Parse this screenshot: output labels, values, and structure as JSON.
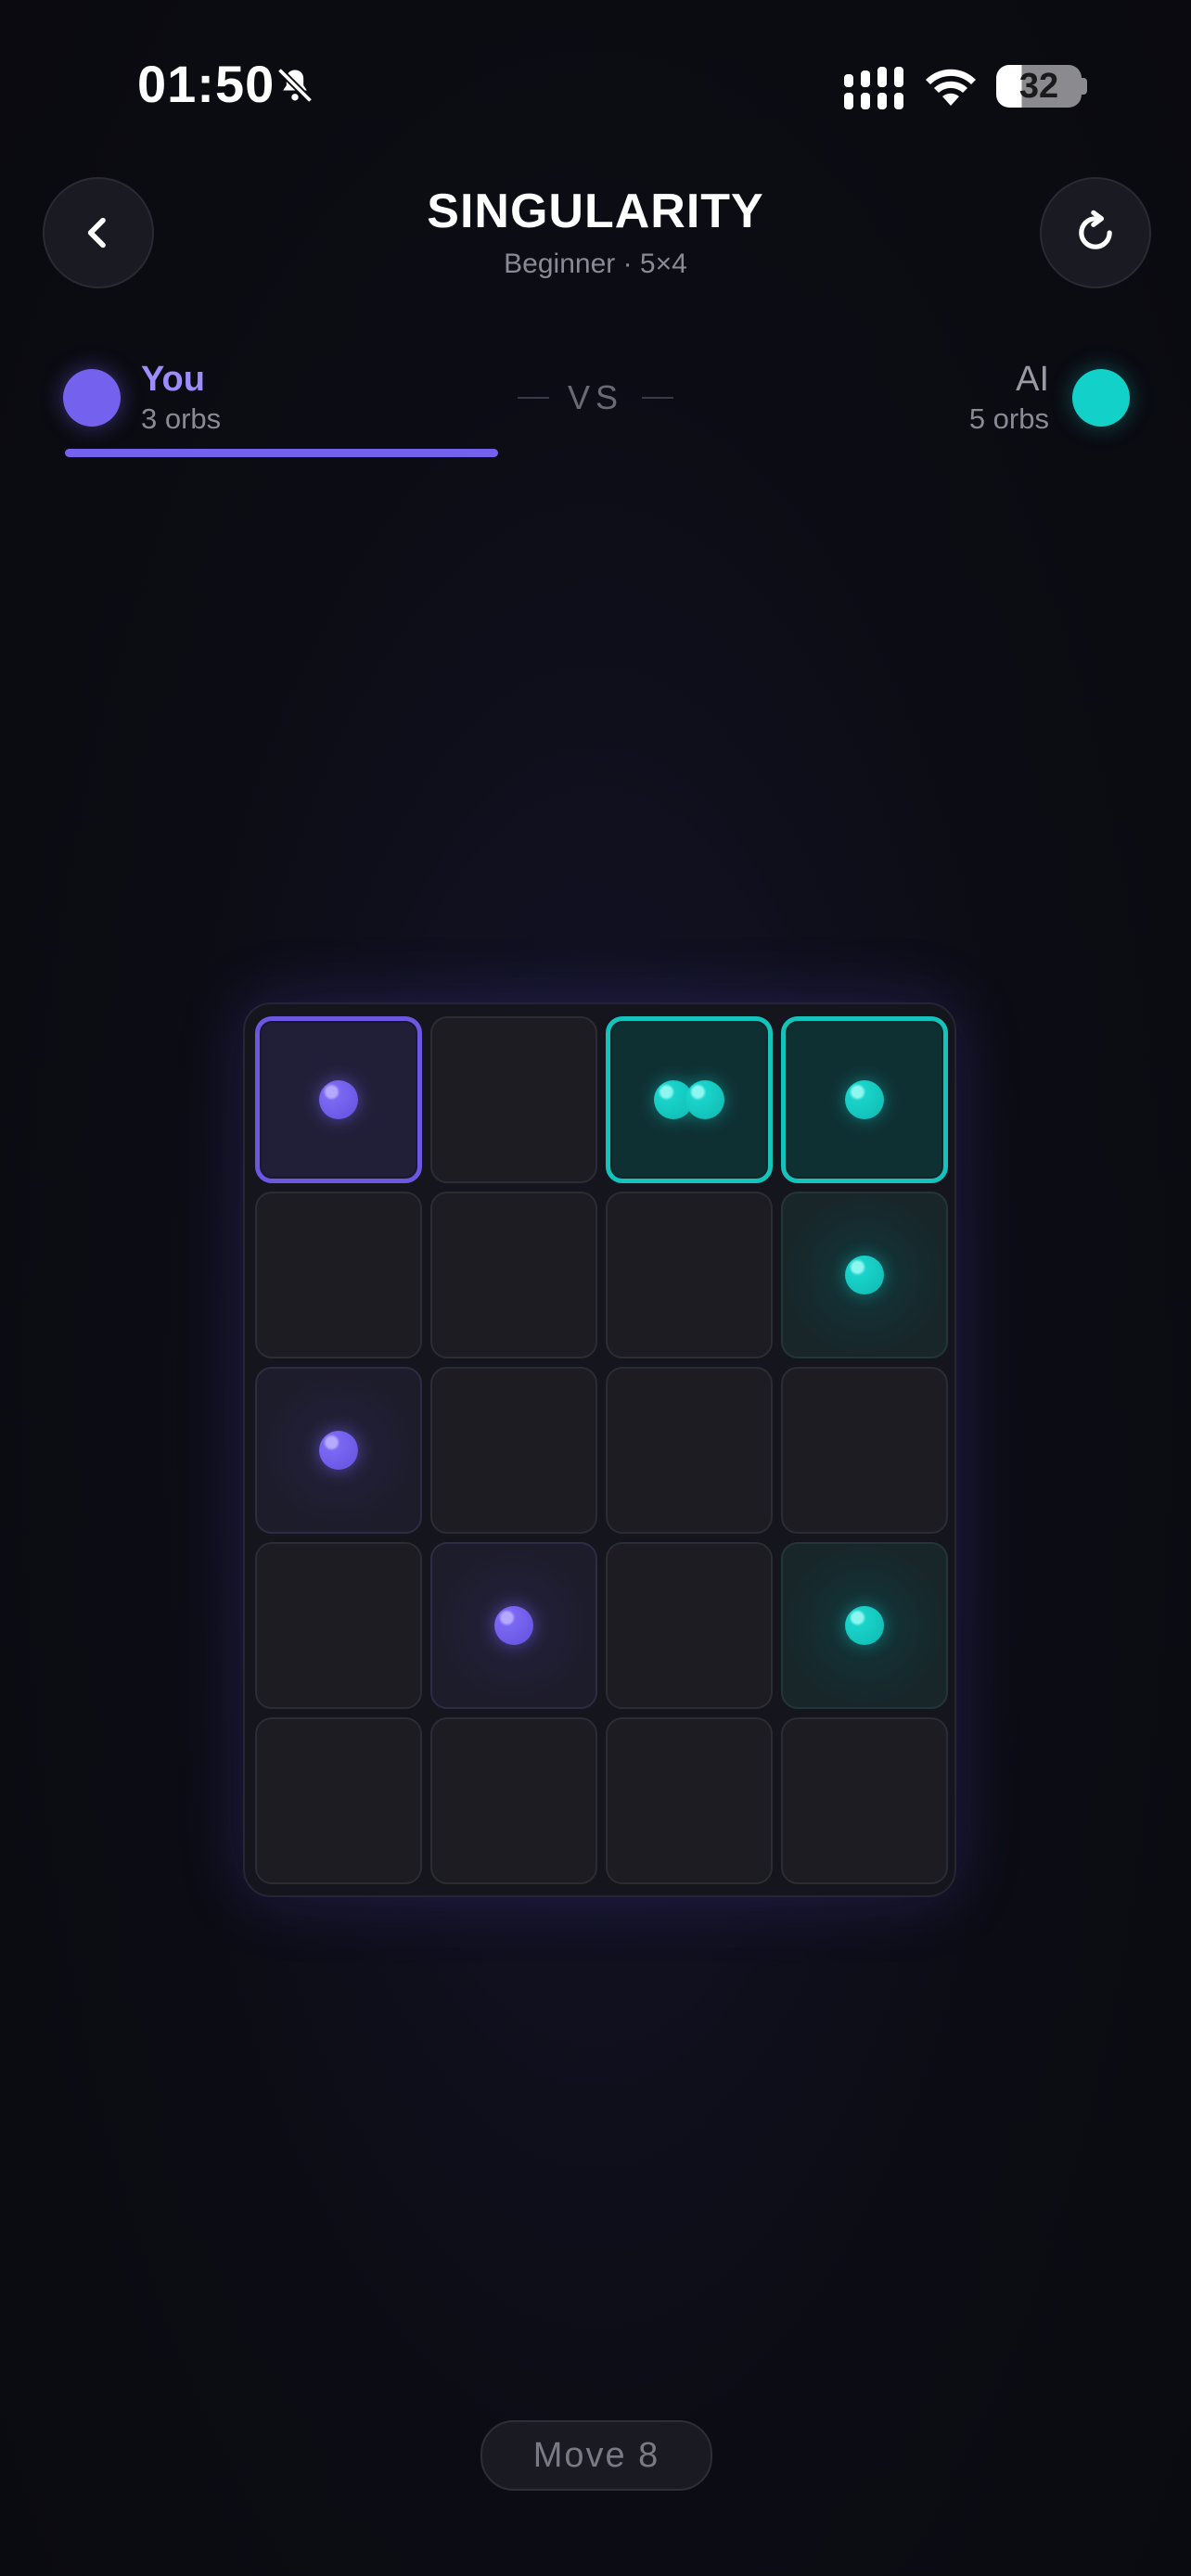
{
  "status_bar": {
    "time": "01:50",
    "battery": "32",
    "icons": [
      "bell-slash-icon",
      "cellular-signal-icon",
      "wifi-icon",
      "battery-icon"
    ]
  },
  "header": {
    "title": "SINGULARITY",
    "subtitle": "Beginner · 5×4",
    "back_icon": "chevron-left-icon",
    "restart_icon": "restart-icon"
  },
  "players": {
    "you": {
      "name": "You",
      "orbs": "3 orbs",
      "color": "#7462ee"
    },
    "ai": {
      "name": "AI",
      "orbs": "5 orbs",
      "color": "#12d1c8"
    },
    "vs": "VS",
    "you_share": 0.375
  },
  "board": {
    "rows": 5,
    "cols": 4,
    "cells": [
      [
        "you1",
        "empty",
        "ai2",
        "ai1"
      ],
      [
        "empty",
        "empty",
        "empty",
        "ai1"
      ],
      [
        "you1",
        "empty",
        "empty",
        "empty"
      ],
      [
        "empty",
        "you1",
        "empty",
        "ai1"
      ],
      [
        "empty",
        "empty",
        "empty",
        "empty"
      ]
    ],
    "highlighted": [
      [
        0,
        0
      ],
      [
        0,
        2
      ],
      [
        0,
        3
      ]
    ]
  },
  "footer": {
    "move": "Move 8"
  }
}
